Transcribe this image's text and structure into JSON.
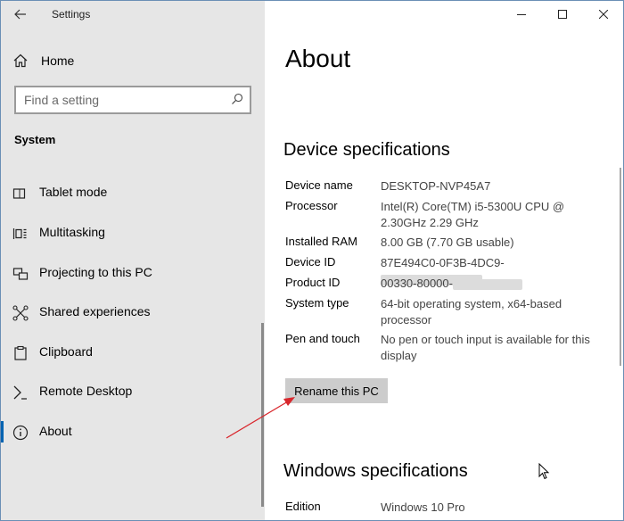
{
  "window": {
    "title": "Settings"
  },
  "sidebar": {
    "home_label": "Home",
    "search_placeholder": "Find a setting",
    "section_title": "System",
    "items": [
      {
        "label": "Tablet mode",
        "icon": "tablet-mode-icon"
      },
      {
        "label": "Multitasking",
        "icon": "multitasking-icon"
      },
      {
        "label": "Projecting to this PC",
        "icon": "projecting-icon"
      },
      {
        "label": "Shared experiences",
        "icon": "shared-experiences-icon"
      },
      {
        "label": "Clipboard",
        "icon": "clipboard-icon"
      },
      {
        "label": "Remote Desktop",
        "icon": "remote-desktop-icon"
      },
      {
        "label": "About",
        "icon": "info-icon",
        "active": true
      }
    ]
  },
  "main": {
    "title": "About",
    "device_specs": {
      "heading": "Device specifications",
      "rows": [
        {
          "label": "Device name",
          "value": "DESKTOP-NVP45A7"
        },
        {
          "label": "Processor",
          "value": "Intel(R) Core(TM) i5-5300U CPU @ 2.30GHz 2.29 GHz"
        },
        {
          "label": "Installed RAM",
          "value": "8.00 GB (7.70 GB usable)"
        },
        {
          "label": "Device ID",
          "value": "87E494C0-0F3B-4DC9-"
        },
        {
          "label": "Product ID",
          "value": "00330-80000-"
        },
        {
          "label": "System type",
          "value": "64-bit operating system, x64-based processor"
        },
        {
          "label": "Pen and touch",
          "value": "No pen or touch input is available for this display"
        }
      ],
      "rename_button": "Rename this PC"
    },
    "windows_specs": {
      "heading": "Windows specifications",
      "rows": [
        {
          "label": "Edition",
          "value": "Windows 10 Pro"
        }
      ]
    }
  },
  "colors": {
    "sidebar_bg": "#e6e6e6",
    "accent": "#0063b1",
    "annotation_arrow": "#d9262c"
  }
}
